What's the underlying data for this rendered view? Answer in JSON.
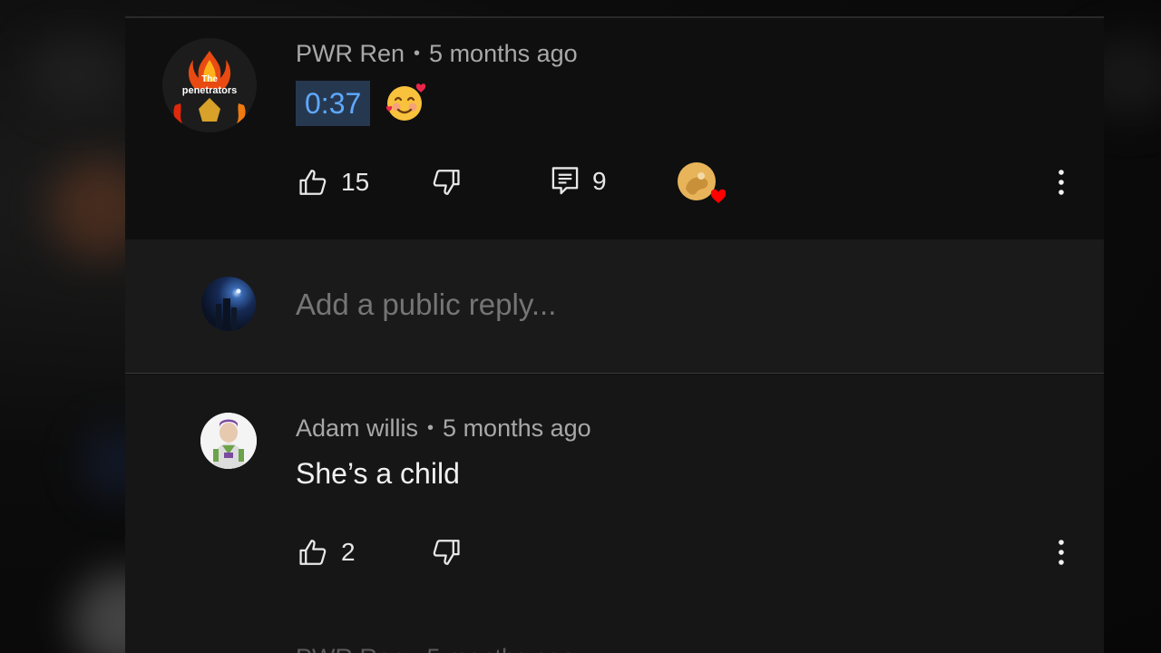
{
  "comments": [
    {
      "author": "PWR Ren",
      "age": "5 months ago",
      "separator": "•",
      "timestamp_link": "0:37",
      "emoji": "smiling-face-with-hearts",
      "avatar_text_top": "The",
      "avatar_text_main": "penetrators",
      "likes": "15",
      "replies": "9",
      "creator_heart": true
    },
    {
      "author": "Adam willis",
      "age": "5 months ago",
      "separator": "•",
      "text": "She’s a child",
      "likes": "2"
    }
  ],
  "reply_box": {
    "placeholder": "Add a public reply..."
  },
  "next_comment_partial": "PWR Ren • 5 months ago",
  "icons": {
    "like": "thumbs-up-icon",
    "dislike": "thumbs-down-icon",
    "replies": "comment-icon",
    "more": "vertical-ellipsis-icon",
    "heart": "heart-icon"
  },
  "colors": {
    "background": "#0f0f0f",
    "reply_bar": "#1a1a1a",
    "link_bg": "#263850",
    "link_text": "#5fa9ff",
    "heart": "#ff0000"
  }
}
